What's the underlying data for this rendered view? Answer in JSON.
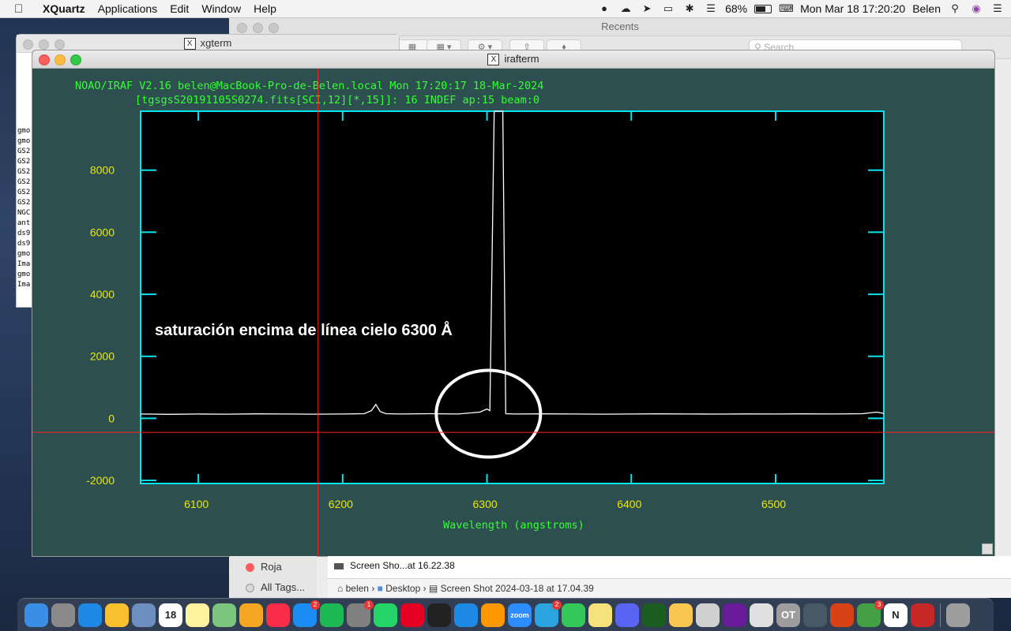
{
  "menubar": {
    "app_name": "XQuartz",
    "menus": [
      "Applications",
      "Edit",
      "Window",
      "Help"
    ],
    "battery": "68%",
    "datetime": "Mon Mar 18  17:20:20",
    "user": "Belen"
  },
  "finder": {
    "title": "Recents",
    "search_placeholder": "Search",
    "sidebar_tags": [
      {
        "label": "Roja",
        "color": "#ff5a5f"
      },
      {
        "label": "All Tags...",
        "color": "#d9d9d9"
      }
    ],
    "file_item": "Screen Sho...at 16.22.38",
    "path": [
      "belen",
      "Desktop",
      "Screen Shot 2024-03-18 at 17.04.39"
    ]
  },
  "xgterm": {
    "title": "xgterm",
    "lines": [
      "gmo",
      "gmo",
      "GS2",
      "GS2",
      "GS2",
      "GS2",
      "GS2",
      "GS2",
      "NGC",
      "ant",
      "ds9",
      "ds9",
      "gmo",
      "Ima",
      "gmo",
      "Ima"
    ]
  },
  "irafterm": {
    "title": "irafterm",
    "header_line1": "NOAO/IRAF V2.16 belen@MacBook-Pro-de-Belen.local Mon 17:20:17 18-Mar-2024",
    "header_line2": "[tgsgsS20191105S0274.fits[SCI,12][*,15]]: 16 INDEF ap:15 beam:0",
    "annotation": "saturación encima de línea cielo 6300 Å"
  },
  "chart_data": {
    "type": "line",
    "title": "NOAO/IRAF V2.16 belen@MacBook-Pro-de-Belen.local Mon 17:20:17 18-Mar-2024",
    "subtitle": "[tgsgsS20191105S0274.fits[SCI,12][*,15]]: 16 INDEF ap:15 beam:0",
    "xlabel": "Wavelength (angstroms)",
    "ylabel": "",
    "xlim": [
      6060,
      6575
    ],
    "ylim": [
      -2100,
      9900
    ],
    "xticks": [
      6100,
      6200,
      6300,
      6400,
      6500
    ],
    "yticks": [
      -2000,
      0,
      2000,
      4000,
      6000,
      8000
    ],
    "cursor": {
      "x": 6183,
      "y": -450
    },
    "colors": {
      "background": "#2e4f4f",
      "plot_bg": "#000000",
      "frame": "#00e5ee",
      "ticklabels": "#e8e800",
      "header": "#33ff33",
      "spectrum": "#ffffff",
      "cursor": "#ff2020"
    },
    "series": [
      {
        "x": [
          6060,
          6080,
          6100,
          6120,
          6140,
          6160,
          6180,
          6200,
          6215,
          6220,
          6223,
          6226,
          6230,
          6240,
          6260,
          6280,
          6295,
          6300,
          6302,
          6305,
          6306,
          6309,
          6311,
          6313,
          6320,
          6340,
          6360,
          6380,
          6400,
          6420,
          6440,
          6460,
          6480,
          6500,
          6520,
          6540,
          6560,
          6570,
          6575
        ],
        "y": [
          140,
          130,
          140,
          135,
          145,
          140,
          135,
          140,
          150,
          250,
          450,
          220,
          150,
          140,
          150,
          140,
          200,
          300,
          250,
          9900,
          9900,
          9900,
          9900,
          150,
          140,
          145,
          140,
          135,
          140,
          145,
          140,
          138,
          142,
          140,
          145,
          140,
          150,
          200,
          160
        ]
      }
    ],
    "highlight": {
      "shape": "ellipse",
      "x": 6301,
      "y": 150
    }
  },
  "dock": [
    {
      "name": "finder",
      "color": "#3a8ee6"
    },
    {
      "name": "launchpad",
      "color": "#8a8a8a"
    },
    {
      "name": "safari",
      "color": "#1e88e5"
    },
    {
      "name": "chrome",
      "color": "#fbc02d"
    },
    {
      "name": "preview",
      "color": "#6d8fbf"
    },
    {
      "name": "calendar",
      "color": "#ffffff",
      "label": "18"
    },
    {
      "name": "notes",
      "color": "#fff3a0"
    },
    {
      "name": "maps",
      "color": "#7bc67e"
    },
    {
      "name": "photos",
      "color": "#f5a623"
    },
    {
      "name": "music",
      "color": "#fa2d48"
    },
    {
      "name": "app-store",
      "color": "#1c8cf5",
      "badge": "2"
    },
    {
      "name": "spotify",
      "color": "#1db954"
    },
    {
      "name": "system-preferences",
      "color": "#808080",
      "badge": "1"
    },
    {
      "name": "whatsapp",
      "color": "#25d366"
    },
    {
      "name": "pinterest",
      "color": "#e60023"
    },
    {
      "name": "terminal",
      "color": "#222222"
    },
    {
      "name": "vscode",
      "color": "#1e88e5"
    },
    {
      "name": "sublime",
      "color": "#ff9800"
    },
    {
      "name": "zoom",
      "color": "#2d8cff",
      "label": "zoom"
    },
    {
      "name": "telegram",
      "color": "#2aa3df",
      "badge": "2"
    },
    {
      "name": "messages",
      "color": "#34c759"
    },
    {
      "name": "stickies",
      "color": "#f6e27a"
    },
    {
      "name": "discord",
      "color": "#5865f2"
    },
    {
      "name": "activity",
      "color": "#1b5e20"
    },
    {
      "name": "cat-app",
      "color": "#f9c74f"
    },
    {
      "name": "textedit",
      "color": "#d0d0d0"
    },
    {
      "name": "galaxy-app",
      "color": "#6a1b9a"
    },
    {
      "name": "script-app",
      "color": "#e0e0e0"
    },
    {
      "name": "ot-app",
      "color": "#9e9e9e",
      "label": "OT"
    },
    {
      "name": "telescope-app",
      "color": "#455a64"
    },
    {
      "name": "compass-app",
      "color": "#d84315"
    },
    {
      "name": "microsoft-app",
      "color": "#43a047",
      "badge": "3"
    },
    {
      "name": "notion",
      "color": "#ffffff",
      "label": "N"
    },
    {
      "name": "photo-booth",
      "color": "#c62828"
    },
    {
      "name": "trash",
      "color": "#9e9e9e"
    }
  ]
}
